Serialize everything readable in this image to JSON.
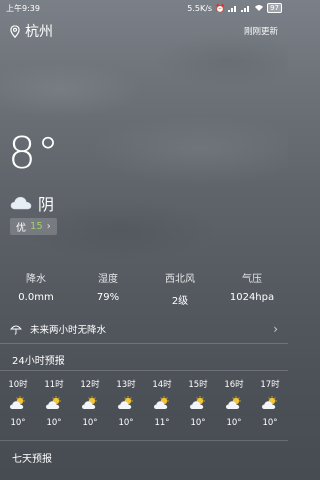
{
  "status_bar": {
    "time": "上午9:39",
    "speed": "5.5K/s",
    "battery": "97"
  },
  "header": {
    "city": "杭州",
    "update_text": "刚刚更新"
  },
  "current": {
    "temperature": "8°",
    "condition": "阴",
    "aqi_label": "优",
    "aqi_value": "15"
  },
  "stats": [
    {
      "label": "降水",
      "value": "0.0mm"
    },
    {
      "label": "湿度",
      "value": "79%"
    },
    {
      "label": "西北风",
      "value": "2级"
    },
    {
      "label": "气压",
      "value": "1024hpa"
    }
  ],
  "rain_notice": "未来两小时无降水",
  "hourly_title": "24小时预报",
  "hourly": [
    {
      "time": "10时",
      "temp": "10°"
    },
    {
      "time": "11时",
      "temp": "10°"
    },
    {
      "time": "12时",
      "temp": "10°"
    },
    {
      "time": "13时",
      "temp": "10°"
    },
    {
      "time": "14时",
      "temp": "11°"
    },
    {
      "time": "15时",
      "temp": "10°"
    },
    {
      "time": "16时",
      "temp": "10°"
    },
    {
      "time": "17时",
      "temp": "10°"
    }
  ],
  "daily_title": "七天预报",
  "colors": {
    "aqi_good": "#9fd06c",
    "sun": "#f5c431"
  },
  "icons": [
    "location-pin-icon",
    "cloud-icon",
    "umbrella-icon",
    "partly-cloudy-icon",
    "chevron-right-icon"
  ]
}
